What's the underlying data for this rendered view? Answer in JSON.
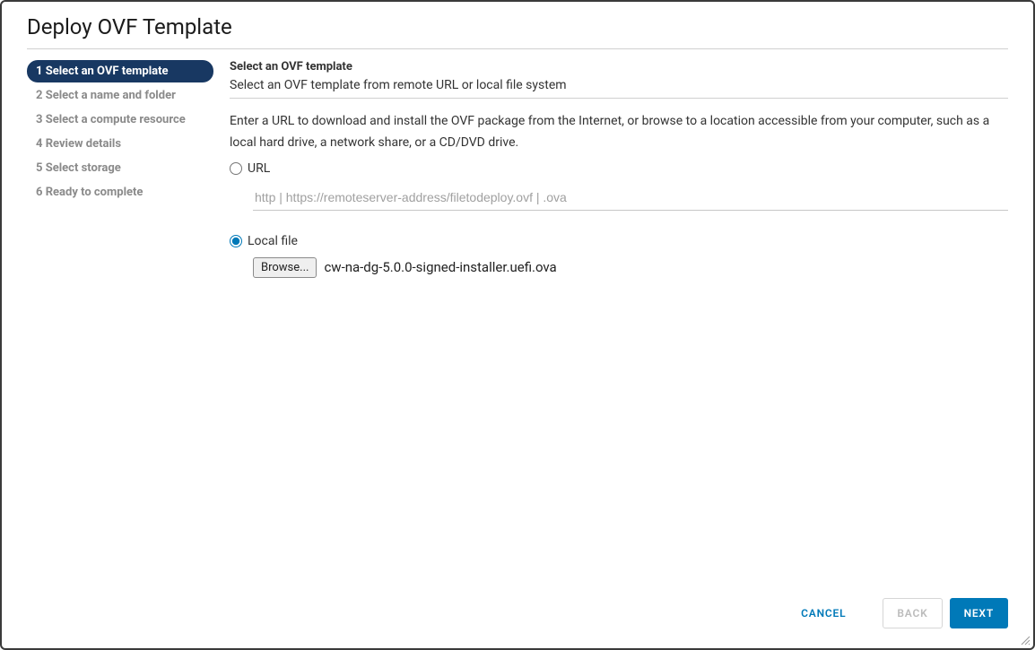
{
  "dialog": {
    "title": "Deploy OVF Template"
  },
  "wizard": {
    "steps": [
      {
        "label": "1 Select an OVF template"
      },
      {
        "label": "2 Select a name and folder"
      },
      {
        "label": "3 Select a compute resource"
      },
      {
        "label": "4 Review details"
      },
      {
        "label": "5 Select storage"
      },
      {
        "label": "6 Ready to complete"
      }
    ]
  },
  "content": {
    "heading": "Select an OVF template",
    "subheading": "Select an OVF template from remote URL or local file system",
    "description": "Enter a URL to download and install the OVF package from the Internet, or browse to a location accessible from your computer, such as a local hard drive, a network share, or a CD/DVD drive.",
    "url_label": "URL",
    "url_placeholder": "http | https://remoteserver-address/filetodeploy.ovf | .ova",
    "local_label": "Local file",
    "browse_label": "Browse...",
    "selected_file": "cw-na-dg-5.0.0-signed-installer.uefi.ova"
  },
  "footer": {
    "cancel": "CANCEL",
    "back": "BACK",
    "next": "NEXT"
  }
}
